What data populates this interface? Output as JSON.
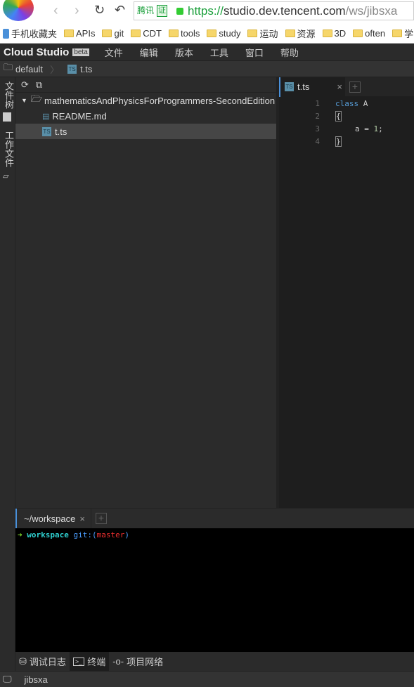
{
  "browser": {
    "url_secure": "https://",
    "url_host": "studio.dev.tencent.com",
    "url_path": "/ws/jibsxa",
    "badge1": "腾讯",
    "badge2": "证",
    "bookmarks": [
      "手机收藏夹",
      "APIs",
      "git",
      "CDT",
      "tools",
      "study",
      "运动",
      "资源",
      "3D",
      "often",
      "学"
    ]
  },
  "menubar": {
    "brand": "Cloud Studio",
    "beta": "beta",
    "items": [
      "文件",
      "编辑",
      "版本",
      "工具",
      "窗口",
      "帮助"
    ]
  },
  "breadcrumb": {
    "workspace": "default",
    "file": "t.ts"
  },
  "sidebar": {
    "tabs": [
      "文件树",
      "工作文件"
    ]
  },
  "tree": {
    "root": "mathematicsAndPhysicsForProgrammers-SecondEdition",
    "files": [
      "README.md",
      "t.ts"
    ],
    "selected": "t.ts"
  },
  "editor": {
    "tab": "t.ts",
    "lines": [
      "1",
      "2",
      "3",
      "4"
    ],
    "code": [
      "class",
      "A",
      "{",
      "a = ",
      "1",
      ";",
      "}"
    ]
  },
  "terminal": {
    "tab": "~/workspace",
    "prompt_arrow": "➜",
    "dir": "workspace",
    "git": "git:(",
    "branch": "master",
    "close": ")"
  },
  "bottom_tabs": [
    "调试日志",
    "终端",
    "项目网络"
  ],
  "status": {
    "workspace": "jibsxa"
  },
  "colors": {
    "accent": "#4a90d9",
    "bg": "#2b2b2b",
    "editor_bg": "#1e1e1e",
    "keyword": "#569cd6"
  }
}
